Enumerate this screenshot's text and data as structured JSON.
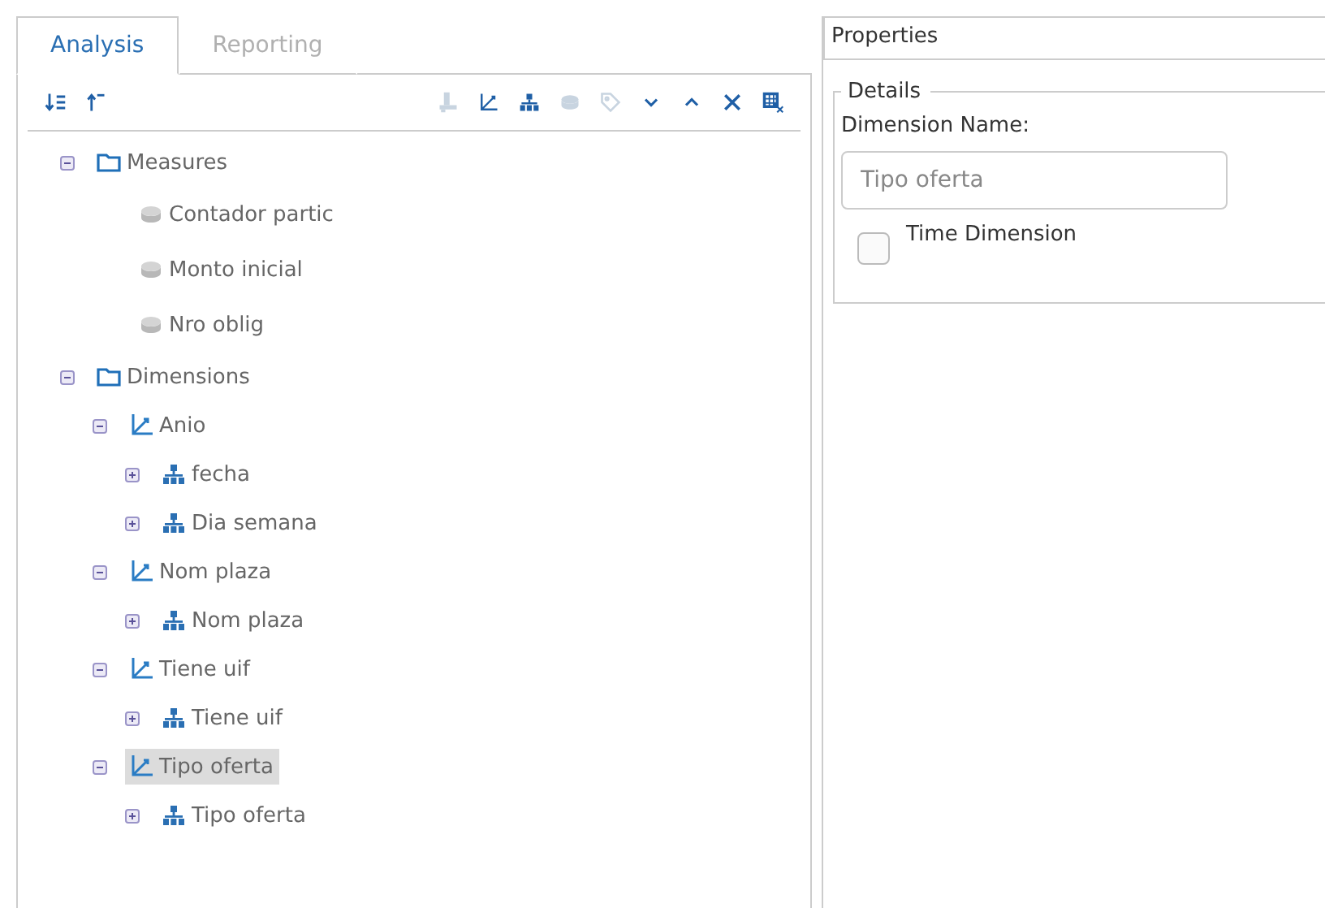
{
  "tabs": [
    {
      "label": "Analysis",
      "selected": true
    },
    {
      "label": "Reporting",
      "selected": false
    }
  ],
  "toolbar": [
    {
      "kind": "sort-down",
      "disabled": false
    },
    {
      "kind": "sort-up",
      "disabled": false
    },
    {
      "kind": "level",
      "disabled": true
    },
    {
      "kind": "dimension",
      "disabled": false
    },
    {
      "kind": "hierarchy",
      "disabled": false
    },
    {
      "kind": "measure",
      "disabled": true
    },
    {
      "kind": "tag",
      "disabled": true
    },
    {
      "kind": "down",
      "disabled": false
    },
    {
      "kind": "up",
      "disabled": false
    },
    {
      "kind": "delete",
      "disabled": false
    },
    {
      "kind": "grid",
      "disabled": false
    }
  ],
  "tree": [
    {
      "kind": "folder",
      "label": "Measures",
      "expanded": true,
      "selected": false,
      "children": [
        {
          "kind": "measure",
          "label": "Contador partic",
          "selected": false
        },
        {
          "kind": "measure",
          "label": "Monto inicial",
          "selected": false
        },
        {
          "kind": "measure",
          "label": "Nro oblig",
          "selected": false
        }
      ]
    },
    {
      "kind": "folder",
      "label": "Dimensions",
      "expanded": true,
      "selected": false,
      "children": [
        {
          "kind": "dimension",
          "label": "Anio",
          "expanded": true,
          "selected": false,
          "children": [
            {
              "kind": "hierarchy",
              "label": "fecha",
              "expanded": false,
              "selected": false
            },
            {
              "kind": "hierarchy",
              "label": "Dia semana",
              "expanded": false,
              "selected": false
            }
          ]
        },
        {
          "kind": "dimension",
          "label": "Nom plaza",
          "expanded": true,
          "selected": false,
          "children": [
            {
              "kind": "hierarchy",
              "label": "Nom plaza",
              "expanded": false,
              "selected": false
            }
          ]
        },
        {
          "kind": "dimension",
          "label": "Tiene uif",
          "expanded": true,
          "selected": false,
          "children": [
            {
              "kind": "hierarchy",
              "label": "Tiene uif",
              "expanded": false,
              "selected": false
            }
          ]
        },
        {
          "kind": "dimension",
          "label": "Tipo oferta",
          "expanded": true,
          "selected": true,
          "children": [
            {
              "kind": "hierarchy",
              "label": "Tipo oferta",
              "expanded": false,
              "selected": false
            }
          ]
        }
      ]
    }
  ],
  "properties": {
    "title": "Properties",
    "group": "Details",
    "field_label": "Dimension Name:",
    "field_value": "Tipo oferta",
    "checkbox_label": "Time Dimension",
    "checked": false
  }
}
